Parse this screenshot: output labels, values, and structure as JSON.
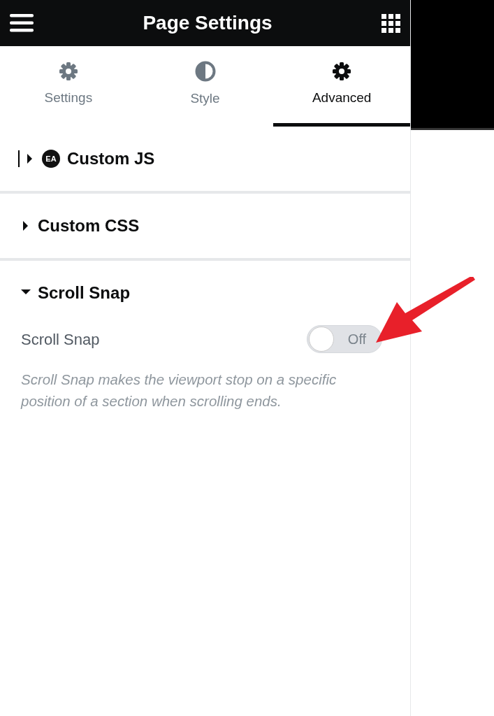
{
  "header": {
    "title": "Page Settings"
  },
  "tabs": [
    {
      "label": "Settings",
      "kind": "gear",
      "selected": false
    },
    {
      "label": "Style",
      "kind": "contrast",
      "selected": false
    },
    {
      "label": "Advanced",
      "kind": "gear",
      "selected": true
    }
  ],
  "sections": [
    {
      "title": "Custom JS",
      "badge": "EA",
      "expanded": false,
      "cursor": true
    },
    {
      "title": "Custom CSS",
      "expanded": false
    },
    {
      "title": "Scroll Snap",
      "expanded": true,
      "controls": [
        {
          "label": "Scroll Snap",
          "on": false,
          "state_text": "Off",
          "description": "Scroll Snap makes the viewport stop on a specific position of a section when scrolling ends."
        }
      ]
    }
  ]
}
